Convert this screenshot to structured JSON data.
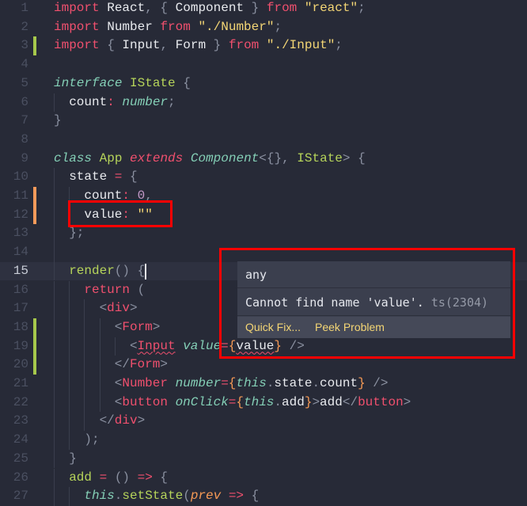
{
  "editor": {
    "current_line": 15,
    "git_markers": {
      "added": [
        3,
        18,
        19,
        20
      ],
      "modified": [
        11,
        12
      ]
    },
    "colors": {
      "added": "#a6c84b",
      "modified": "#f59a5a",
      "background": "#272a37",
      "highlight_box": "#ff0000"
    },
    "lines": [
      {
        "n": "1",
        "indent": 0,
        "tokens": [
          [
            "import",
            "k"
          ],
          [
            " React",
            "i"
          ],
          [
            ", ",
            "p"
          ],
          [
            "{",
            "p"
          ],
          [
            " Component ",
            "i"
          ],
          [
            "}",
            "p"
          ],
          [
            " from ",
            "k"
          ],
          [
            "\"react\"",
            "s"
          ],
          [
            ";",
            "p"
          ]
        ]
      },
      {
        "n": "2",
        "indent": 0,
        "tokens": [
          [
            "import",
            "k"
          ],
          [
            " Number ",
            "i"
          ],
          [
            "from ",
            "k"
          ],
          [
            "\"./Number\"",
            "s"
          ],
          [
            ";",
            "p"
          ]
        ]
      },
      {
        "n": "3",
        "indent": 0,
        "tokens": [
          [
            "import",
            "k"
          ],
          [
            " { ",
            "p"
          ],
          [
            "Input",
            "i"
          ],
          [
            ", ",
            "p"
          ],
          [
            "Form",
            "i"
          ],
          [
            " } ",
            "p"
          ],
          [
            "from ",
            "k"
          ],
          [
            "\"./Input\"",
            "s"
          ],
          [
            ";",
            "p"
          ]
        ]
      },
      {
        "n": "4",
        "indent": 0,
        "tokens": []
      },
      {
        "n": "5",
        "indent": 0,
        "tokens": [
          [
            "interface",
            "t"
          ],
          [
            " IState ",
            "g"
          ],
          [
            "{",
            "p"
          ]
        ]
      },
      {
        "n": "6",
        "indent": 1,
        "tokens": [
          [
            "count",
            "i"
          ],
          [
            ": ",
            "k"
          ],
          [
            "number",
            "t"
          ],
          [
            ";",
            "p"
          ]
        ]
      },
      {
        "n": "7",
        "indent": 0,
        "tokens": [
          [
            "}",
            "p"
          ]
        ]
      },
      {
        "n": "8",
        "indent": 0,
        "tokens": []
      },
      {
        "n": "9",
        "indent": 0,
        "tokens": [
          [
            "class",
            "t"
          ],
          [
            " App ",
            "g"
          ],
          [
            "extends",
            "kk"
          ],
          [
            " Component",
            "t"
          ],
          [
            "<{}, ",
            "p"
          ],
          [
            "IState",
            "g"
          ],
          [
            "> {",
            "p"
          ]
        ]
      },
      {
        "n": "10",
        "indent": 1,
        "tokens": [
          [
            "state",
            "i"
          ],
          [
            " = ",
            "k"
          ],
          [
            "{",
            "p"
          ]
        ]
      },
      {
        "n": "11",
        "indent": 2,
        "tokens": [
          [
            "count",
            "i"
          ],
          [
            ": ",
            "k"
          ],
          [
            "0",
            "n"
          ],
          [
            ",",
            "p"
          ]
        ]
      },
      {
        "n": "12",
        "indent": 2,
        "tokens": [
          [
            "value",
            "i"
          ],
          [
            ": ",
            "k"
          ],
          [
            "\"\"",
            "s"
          ]
        ]
      },
      {
        "n": "13",
        "indent": 1,
        "tokens": [
          [
            "};",
            "p"
          ]
        ]
      },
      {
        "n": "14",
        "indent": 1,
        "tokens": []
      },
      {
        "n": "15",
        "indent": 1,
        "tokens": [
          [
            "render",
            "g"
          ],
          [
            "() {",
            "p"
          ]
        ]
      },
      {
        "n": "16",
        "indent": 2,
        "tokens": [
          [
            "return",
            "k"
          ],
          [
            " (",
            "p"
          ]
        ]
      },
      {
        "n": "17",
        "indent": 3,
        "tokens": [
          [
            "<",
            "p"
          ],
          [
            "div",
            "k"
          ],
          [
            ">",
            "p"
          ]
        ]
      },
      {
        "n": "18",
        "indent": 4,
        "tokens": [
          [
            "<",
            "p"
          ],
          [
            "Form",
            "k"
          ],
          [
            ">",
            "p"
          ]
        ]
      },
      {
        "n": "19",
        "indent": 5,
        "tokens": [
          [
            "<",
            "p"
          ],
          [
            "Input",
            "k sq"
          ],
          [
            " value",
            "t"
          ],
          [
            "=",
            "k"
          ],
          [
            "{",
            "o"
          ],
          [
            "value",
            "i sq"
          ],
          [
            "}",
            "o"
          ],
          [
            " />",
            "p"
          ]
        ]
      },
      {
        "n": "20",
        "indent": 4,
        "tokens": [
          [
            "</",
            "p"
          ],
          [
            "Form",
            "k"
          ],
          [
            ">",
            "p"
          ]
        ]
      },
      {
        "n": "21",
        "indent": 4,
        "tokens": [
          [
            "<",
            "p"
          ],
          [
            "Number",
            "k"
          ],
          [
            " number",
            "t"
          ],
          [
            "=",
            "k"
          ],
          [
            "{",
            "o"
          ],
          [
            "this",
            "t"
          ],
          [
            ".",
            "p"
          ],
          [
            "state",
            "i"
          ],
          [
            ".",
            "p"
          ],
          [
            "count",
            "i"
          ],
          [
            "}",
            "o"
          ],
          [
            " />",
            "p"
          ]
        ]
      },
      {
        "n": "22",
        "indent": 4,
        "tokens": [
          [
            "<",
            "p"
          ],
          [
            "button",
            "k"
          ],
          [
            " onClick",
            "t"
          ],
          [
            "=",
            "k"
          ],
          [
            "{",
            "o"
          ],
          [
            "this",
            "t"
          ],
          [
            ".",
            "p"
          ],
          [
            "add",
            "i"
          ],
          [
            "}",
            "o"
          ],
          [
            ">",
            "p"
          ],
          [
            "add",
            "i"
          ],
          [
            "</",
            "p"
          ],
          [
            "button",
            "k"
          ],
          [
            ">",
            "p"
          ]
        ]
      },
      {
        "n": "23",
        "indent": 3,
        "tokens": [
          [
            "</",
            "p"
          ],
          [
            "div",
            "k"
          ],
          [
            ">",
            "p"
          ]
        ]
      },
      {
        "n": "24",
        "indent": 2,
        "tokens": [
          [
            ");",
            "p"
          ]
        ]
      },
      {
        "n": "25",
        "indent": 1,
        "tokens": [
          [
            "}",
            "p"
          ]
        ]
      },
      {
        "n": "26",
        "indent": 1,
        "tokens": [
          [
            "add",
            "g"
          ],
          [
            " = ",
            "k"
          ],
          [
            "() ",
            "p"
          ],
          [
            "=>",
            "k"
          ],
          [
            " {",
            "p"
          ]
        ]
      },
      {
        "n": "27",
        "indent": 2,
        "tokens": [
          [
            "this",
            "t"
          ],
          [
            ".",
            "p"
          ],
          [
            "setState",
            "g"
          ],
          [
            "(",
            "p"
          ],
          [
            "prev",
            "oi"
          ],
          [
            " =>",
            "k"
          ],
          [
            " {",
            "p"
          ]
        ]
      }
    ]
  },
  "hover": {
    "type": "any",
    "message": "Cannot find name 'value'.",
    "code": "ts(2304)",
    "actions": [
      "Quick Fix...",
      "Peek Problem"
    ]
  }
}
